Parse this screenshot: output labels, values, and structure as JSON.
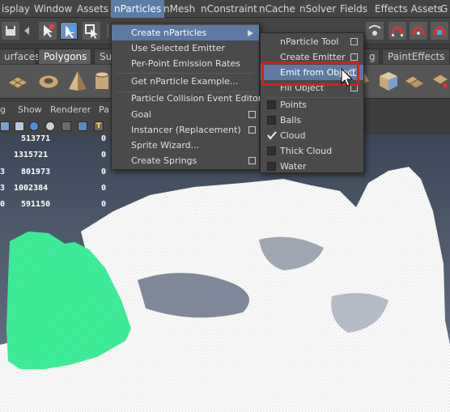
{
  "menubar": {
    "items": [
      "isplay",
      "Window",
      "Assets",
      "nParticles",
      "nMesh",
      "nConstraint",
      "nCache",
      "nSolver",
      "Fields",
      "Effects Assets",
      "G"
    ],
    "active_index": 3
  },
  "shelf_tabs": {
    "items": [
      "urfaces",
      "Polygons",
      "Su",
      "g",
      "PaintEffects"
    ],
    "active_index": 1
  },
  "panel": {
    "menu_items": [
      "g",
      "Show",
      "Renderer",
      "Pa"
    ]
  },
  "hud": {
    "rows": [
      {
        "left": "",
        "value": "513771",
        "right": "0"
      },
      {
        "left": "",
        "value": "1315721",
        "right": "0"
      },
      {
        "left": "3",
        "value": "801973",
        "right": "0"
      },
      {
        "left": "3",
        "value": "1002384",
        "right": "0"
      },
      {
        "left": "0",
        "value": "591150",
        "right": "0"
      }
    ]
  },
  "nparticles_menu": {
    "items": [
      {
        "label": "Create nParticles",
        "submenu": true,
        "highlighted": true,
        "option_box": false
      },
      {
        "label": "Use Selected Emitter",
        "option_box": false
      },
      {
        "label": "Per-Point Emission Rates",
        "option_box": false
      },
      {
        "separator": true
      },
      {
        "label": "Get nParticle Example...",
        "option_box": false
      },
      {
        "separator": true
      },
      {
        "label": "Particle Collision Event Editor",
        "option_box": false
      },
      {
        "label": "Goal",
        "option_box": true
      },
      {
        "label": "Instancer (Replacement)",
        "option_box": true
      },
      {
        "label": "Sprite Wizard...",
        "option_box": false
      },
      {
        "label": "Create Springs",
        "option_box": true
      }
    ]
  },
  "create_submenu": {
    "items": [
      {
        "label": "nParticle Tool",
        "option_box": true
      },
      {
        "label": "Create Emitter",
        "option_box": true
      },
      {
        "label": "Emit from Object",
        "option_box": true,
        "highlighted": true
      },
      {
        "label": "Fill Object",
        "option_box": true
      },
      {
        "separator": true
      },
      {
        "label": "Points",
        "check": false
      },
      {
        "label": "Balls",
        "check": false
      },
      {
        "label": "Cloud",
        "check": true
      },
      {
        "label": "Thick Cloud",
        "check": false
      },
      {
        "label": "Water",
        "check": false
      }
    ]
  },
  "colors": {
    "menu_highlight": "#5c7aa3",
    "callout": "#d21f1f",
    "mesh_green": "#3ff09a",
    "mesh_white": "#ffffff"
  },
  "icons": {
    "cursor": "arrow-pointer-icon",
    "submenu": "triangle-right-icon",
    "option_box": "option-box-icon",
    "check": "check-mark-icon"
  }
}
